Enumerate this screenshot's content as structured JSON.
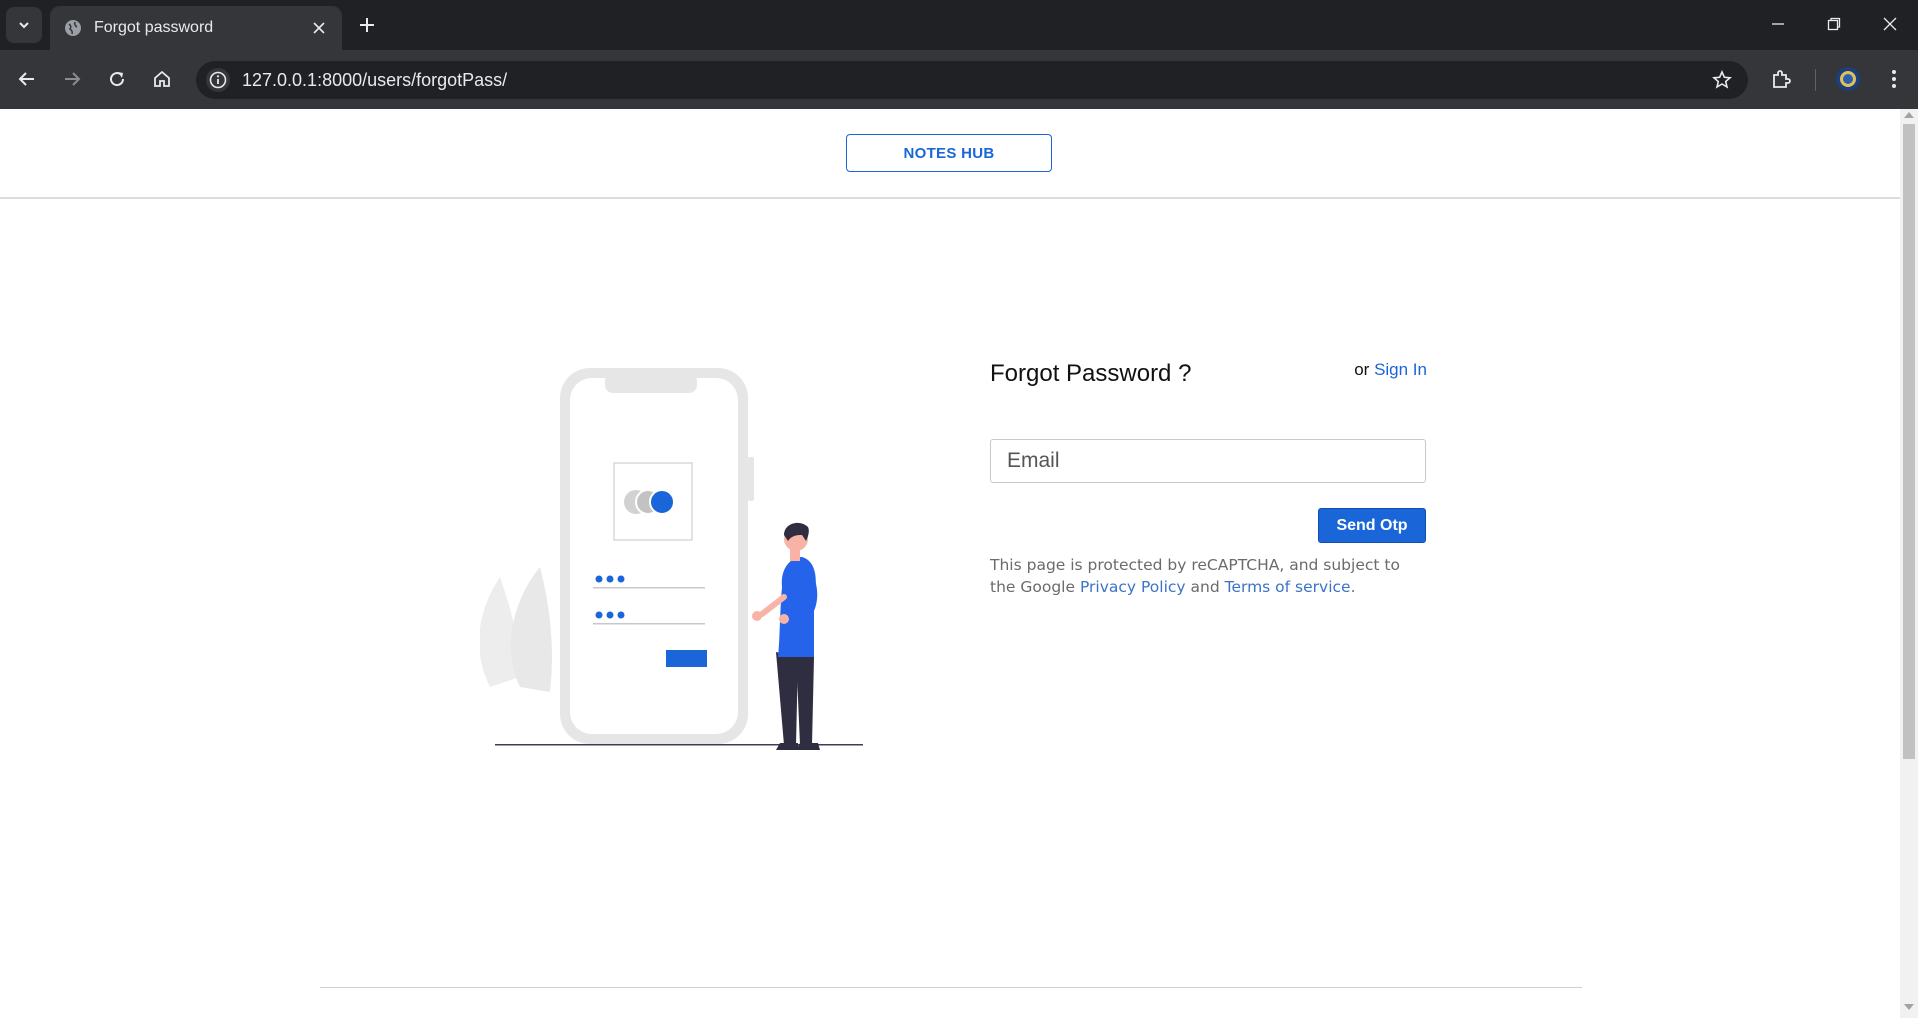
{
  "browser": {
    "tab_title": "Forgot password",
    "url": "127.0.0.1:8000/users/forgotPass/"
  },
  "header": {
    "brand": "NOTES HUB"
  },
  "form": {
    "title": "Forgot Password ?",
    "or_text": "or ",
    "signin_label": "Sign In",
    "email_placeholder": "Email",
    "submit_label": "Send Otp",
    "notice_text": "This page is protected by reCAPTCHA, and subject to the Google ",
    "privacy_label": "Privacy Policy",
    "and_text": " and ",
    "terms_label": "Terms of service",
    "period": "."
  },
  "colors": {
    "accent": "#1a66d9",
    "figure_shirt": "#2563eb",
    "phone_gray": "#e6e6e6"
  },
  "icons": [
    "chevron-down-icon",
    "globe-icon",
    "close-icon",
    "plus-icon",
    "minimize-icon",
    "restore-icon",
    "window-close-icon",
    "back-icon",
    "forward-icon",
    "reload-icon",
    "home-icon",
    "info-icon",
    "star-icon",
    "extensions-icon",
    "profile-icon",
    "kebab-menu-icon"
  ]
}
